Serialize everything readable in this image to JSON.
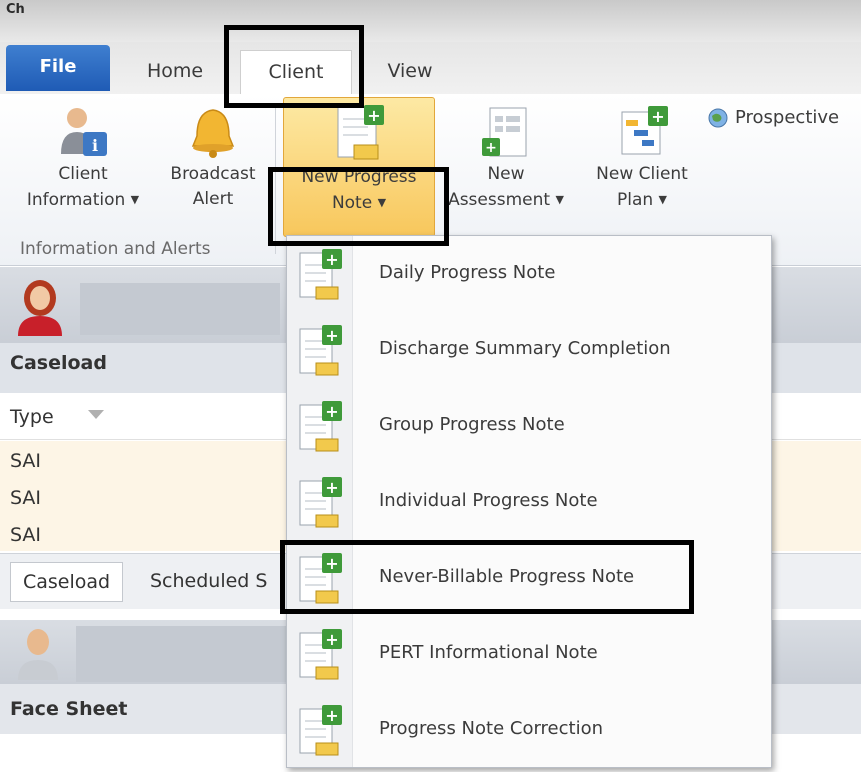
{
  "app": {
    "title_glyph": "Ch"
  },
  "tabs": {
    "file": "File",
    "home": "Home",
    "client": "Client",
    "view": "View"
  },
  "ribbon": {
    "client_information": [
      "Client",
      "Information"
    ],
    "broadcast_alert": [
      "Broadcast",
      "Alert"
    ],
    "new_progress_note": [
      "New Progress",
      "Note"
    ],
    "new_assessment": [
      "New",
      "Assessment"
    ],
    "new_client_plan": [
      "New Client",
      "Plan"
    ],
    "prospective": "Prospective",
    "group_label": "Information and Alerts"
  },
  "caseload": {
    "title": "Caseload",
    "column_type": "Type",
    "rows": [
      "SAI",
      "SAI",
      "SAI"
    ],
    "tab_caseload": "Caseload",
    "tab_scheduled": "Scheduled S"
  },
  "face_sheet": {
    "title": "Face Sheet"
  },
  "menu": {
    "items": [
      "Daily Progress Note",
      "Discharge Summary Completion",
      "Group Progress Note",
      "Individual Progress Note",
      "Never-Billable Progress Note",
      "PERT Informational Note",
      "Progress Note Correction"
    ]
  },
  "colors": {
    "file_tab": "#2b6bc4",
    "highlight": "#f8c75c",
    "annotation_box": "#000000"
  }
}
